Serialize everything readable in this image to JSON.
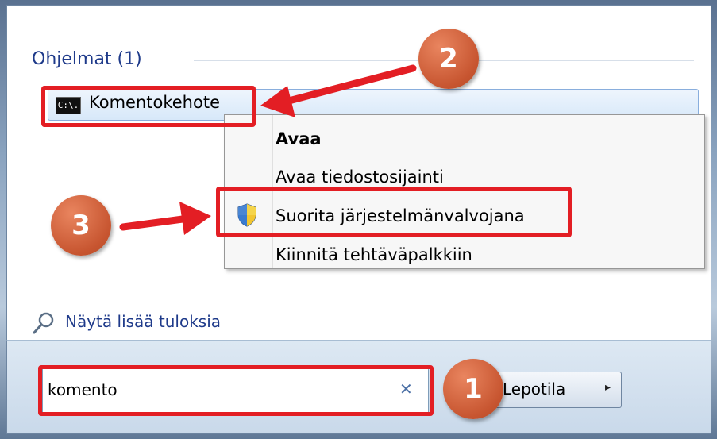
{
  "programs": {
    "section_title": "Ohjelmat (1)",
    "result_icon_text": "C:\\.",
    "result_label": "Komentokehote"
  },
  "context_menu": {
    "items": [
      {
        "label": "Avaa",
        "bold": true
      },
      {
        "label": "Avaa tiedostosijainti"
      },
      {
        "label": "Suorita järjestelmänvalvojana",
        "icon": "uac-shield-icon"
      },
      {
        "label": "Kiinnitä tehtäväpalkkiin"
      }
    ]
  },
  "show_more": {
    "label": "Näytä lisää tuloksia",
    "icon": "search-icon"
  },
  "search": {
    "value": "komento",
    "clear_icon": "✕"
  },
  "power": {
    "label": "Lepotila",
    "arrow": "▸"
  },
  "annotations": {
    "badges": [
      "1",
      "2",
      "3"
    ],
    "color": "#e31e24",
    "badge_color": "#c75530"
  }
}
